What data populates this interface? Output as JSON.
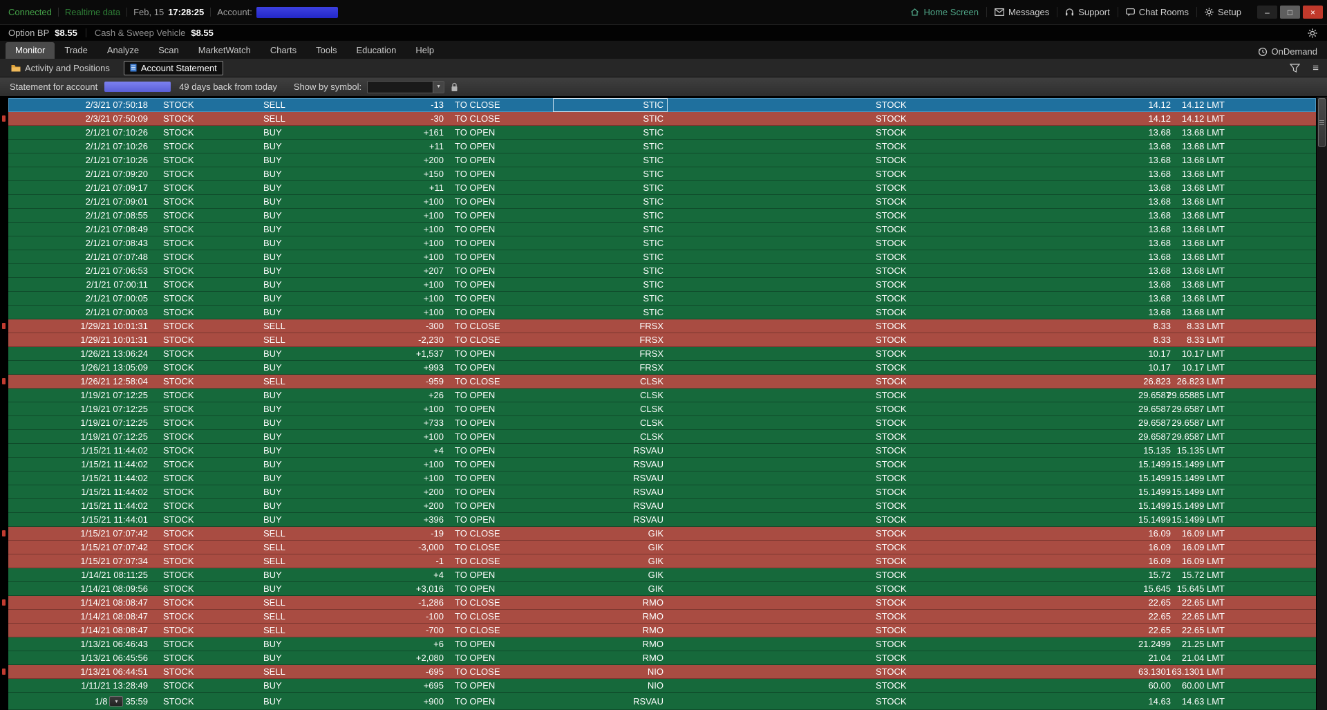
{
  "colors": {
    "buy_row": "#16693B",
    "sell_row": "#A94C42",
    "selected_row": "#1F709E",
    "account_redaction": "#3134D8",
    "statement_redaction": "#6B70E8",
    "connected_green": "#44A148",
    "close_button_red": "#C0392B",
    "folder_icon_orange": "#DFA238",
    "document_icon_blue": "#3B7BD0"
  },
  "top_bar": {
    "connection_status": "Connected",
    "data_status": "Realtime data",
    "date": "Feb, 15",
    "time": "17:28:25",
    "account_label": "Account:",
    "links": [
      {
        "label": "Home Screen",
        "icon": "home-icon"
      },
      {
        "label": "Messages",
        "icon": "envelope-icon"
      },
      {
        "label": "Support",
        "icon": "headset-icon"
      },
      {
        "label": "Chat Rooms",
        "icon": "chat-bubble-icon"
      },
      {
        "label": "Setup",
        "icon": "gear-icon"
      }
    ],
    "window_controls": {
      "minimize": "–",
      "maximize": "□",
      "close": "×"
    }
  },
  "bp_bar": {
    "option_bp_label": "Option BP",
    "option_bp_value": "$8.55",
    "sweep_label": "Cash & Sweep Vehicle",
    "sweep_value": "$8.55"
  },
  "menu": {
    "tabs": [
      "Monitor",
      "Trade",
      "Analyze",
      "Scan",
      "MarketWatch",
      "Charts",
      "Tools",
      "Education",
      "Help"
    ],
    "active": "Monitor",
    "ondemand_label": "OnDemand"
  },
  "subtabs": {
    "items": [
      {
        "label": "Activity and Positions",
        "icon": "folder-icon"
      },
      {
        "label": "Account Statement",
        "icon": "document-icon"
      }
    ],
    "active": "Account Statement"
  },
  "toolbar": {
    "statement_label": "Statement for account",
    "days_back_label": "49 days back from today",
    "show_by_label": "Show by symbol:",
    "symbol_dropdown_value": ""
  },
  "table": {
    "rows": [
      {
        "time": "2/3/21 07:50:18",
        "spread": "STOCK",
        "side": "SELL",
        "qty": "-13",
        "effect": "TO CLOSE",
        "symbol": "STIC",
        "type": "STOCK",
        "price": "14.12",
        "net": "14.12 LMT",
        "selected": true
      },
      {
        "time": "2/3/21 07:50:09",
        "spread": "STOCK",
        "side": "SELL",
        "qty": "-30",
        "effect": "TO CLOSE",
        "symbol": "STIC",
        "type": "STOCK",
        "price": "14.12",
        "net": "14.12 LMT"
      },
      {
        "time": "2/1/21 07:10:26",
        "spread": "STOCK",
        "side": "BUY",
        "qty": "+161",
        "effect": "TO OPEN",
        "symbol": "STIC",
        "type": "STOCK",
        "price": "13.68",
        "net": "13.68 LMT"
      },
      {
        "time": "2/1/21 07:10:26",
        "spread": "STOCK",
        "side": "BUY",
        "qty": "+11",
        "effect": "TO OPEN",
        "symbol": "STIC",
        "type": "STOCK",
        "price": "13.68",
        "net": "13.68 LMT"
      },
      {
        "time": "2/1/21 07:10:26",
        "spread": "STOCK",
        "side": "BUY",
        "qty": "+200",
        "effect": "TO OPEN",
        "symbol": "STIC",
        "type": "STOCK",
        "price": "13.68",
        "net": "13.68 LMT"
      },
      {
        "time": "2/1/21 07:09:20",
        "spread": "STOCK",
        "side": "BUY",
        "qty": "+150",
        "effect": "TO OPEN",
        "symbol": "STIC",
        "type": "STOCK",
        "price": "13.68",
        "net": "13.68 LMT"
      },
      {
        "time": "2/1/21 07:09:17",
        "spread": "STOCK",
        "side": "BUY",
        "qty": "+11",
        "effect": "TO OPEN",
        "symbol": "STIC",
        "type": "STOCK",
        "price": "13.68",
        "net": "13.68 LMT"
      },
      {
        "time": "2/1/21 07:09:01",
        "spread": "STOCK",
        "side": "BUY",
        "qty": "+100",
        "effect": "TO OPEN",
        "symbol": "STIC",
        "type": "STOCK",
        "price": "13.68",
        "net": "13.68 LMT"
      },
      {
        "time": "2/1/21 07:08:55",
        "spread": "STOCK",
        "side": "BUY",
        "qty": "+100",
        "effect": "TO OPEN",
        "symbol": "STIC",
        "type": "STOCK",
        "price": "13.68",
        "net": "13.68 LMT"
      },
      {
        "time": "2/1/21 07:08:49",
        "spread": "STOCK",
        "side": "BUY",
        "qty": "+100",
        "effect": "TO OPEN",
        "symbol": "STIC",
        "type": "STOCK",
        "price": "13.68",
        "net": "13.68 LMT"
      },
      {
        "time": "2/1/21 07:08:43",
        "spread": "STOCK",
        "side": "BUY",
        "qty": "+100",
        "effect": "TO OPEN",
        "symbol": "STIC",
        "type": "STOCK",
        "price": "13.68",
        "net": "13.68 LMT"
      },
      {
        "time": "2/1/21 07:07:48",
        "spread": "STOCK",
        "side": "BUY",
        "qty": "+100",
        "effect": "TO OPEN",
        "symbol": "STIC",
        "type": "STOCK",
        "price": "13.68",
        "net": "13.68 LMT"
      },
      {
        "time": "2/1/21 07:06:53",
        "spread": "STOCK",
        "side": "BUY",
        "qty": "+207",
        "effect": "TO OPEN",
        "symbol": "STIC",
        "type": "STOCK",
        "price": "13.68",
        "net": "13.68 LMT"
      },
      {
        "time": "2/1/21 07:00:11",
        "spread": "STOCK",
        "side": "BUY",
        "qty": "+100",
        "effect": "TO OPEN",
        "symbol": "STIC",
        "type": "STOCK",
        "price": "13.68",
        "net": "13.68 LMT"
      },
      {
        "time": "2/1/21 07:00:05",
        "spread": "STOCK",
        "side": "BUY",
        "qty": "+100",
        "effect": "TO OPEN",
        "symbol": "STIC",
        "type": "STOCK",
        "price": "13.68",
        "net": "13.68 LMT"
      },
      {
        "time": "2/1/21 07:00:03",
        "spread": "STOCK",
        "side": "BUY",
        "qty": "+100",
        "effect": "TO OPEN",
        "symbol": "STIC",
        "type": "STOCK",
        "price": "13.68",
        "net": "13.68 LMT"
      },
      {
        "time": "1/29/21 10:01:31",
        "spread": "STOCK",
        "side": "SELL",
        "qty": "-300",
        "effect": "TO CLOSE",
        "symbol": "FRSX",
        "type": "STOCK",
        "price": "8.33",
        "net": "8.33 LMT"
      },
      {
        "time": "1/29/21 10:01:31",
        "spread": "STOCK",
        "side": "SELL",
        "qty": "-2,230",
        "effect": "TO CLOSE",
        "symbol": "FRSX",
        "type": "STOCK",
        "price": "8.33",
        "net": "8.33 LMT"
      },
      {
        "time": "1/26/21 13:06:24",
        "spread": "STOCK",
        "side": "BUY",
        "qty": "+1,537",
        "effect": "TO OPEN",
        "symbol": "FRSX",
        "type": "STOCK",
        "price": "10.17",
        "net": "10.17 LMT"
      },
      {
        "time": "1/26/21 13:05:09",
        "spread": "STOCK",
        "side": "BUY",
        "qty": "+993",
        "effect": "TO OPEN",
        "symbol": "FRSX",
        "type": "STOCK",
        "price": "10.17",
        "net": "10.17 LMT"
      },
      {
        "time": "1/26/21 12:58:04",
        "spread": "STOCK",
        "side": "SELL",
        "qty": "-959",
        "effect": "TO CLOSE",
        "symbol": "CLSK",
        "type": "STOCK",
        "price": "26.823",
        "net": "26.823 LMT"
      },
      {
        "time": "1/19/21 07:12:25",
        "spread": "STOCK",
        "side": "BUY",
        "qty": "+26",
        "effect": "TO OPEN",
        "symbol": "CLSK",
        "type": "STOCK",
        "price": "29.6587",
        "net": "29.65885 LMT"
      },
      {
        "time": "1/19/21 07:12:25",
        "spread": "STOCK",
        "side": "BUY",
        "qty": "+100",
        "effect": "TO OPEN",
        "symbol": "CLSK",
        "type": "STOCK",
        "price": "29.6587",
        "net": "29.6587 LMT"
      },
      {
        "time": "1/19/21 07:12:25",
        "spread": "STOCK",
        "side": "BUY",
        "qty": "+733",
        "effect": "TO OPEN",
        "symbol": "CLSK",
        "type": "STOCK",
        "price": "29.6587",
        "net": "29.6587 LMT"
      },
      {
        "time": "1/19/21 07:12:25",
        "spread": "STOCK",
        "side": "BUY",
        "qty": "+100",
        "effect": "TO OPEN",
        "symbol": "CLSK",
        "type": "STOCK",
        "price": "29.6587",
        "net": "29.6587 LMT"
      },
      {
        "time": "1/15/21 11:44:02",
        "spread": "STOCK",
        "side": "BUY",
        "qty": "+4",
        "effect": "TO OPEN",
        "symbol": "RSVAU",
        "type": "STOCK",
        "price": "15.135",
        "net": "15.135 LMT"
      },
      {
        "time": "1/15/21 11:44:02",
        "spread": "STOCK",
        "side": "BUY",
        "qty": "+100",
        "effect": "TO OPEN",
        "symbol": "RSVAU",
        "type": "STOCK",
        "price": "15.1499",
        "net": "15.1499 LMT"
      },
      {
        "time": "1/15/21 11:44:02",
        "spread": "STOCK",
        "side": "BUY",
        "qty": "+100",
        "effect": "TO OPEN",
        "symbol": "RSVAU",
        "type": "STOCK",
        "price": "15.1499",
        "net": "15.1499 LMT"
      },
      {
        "time": "1/15/21 11:44:02",
        "spread": "STOCK",
        "side": "BUY",
        "qty": "+200",
        "effect": "TO OPEN",
        "symbol": "RSVAU",
        "type": "STOCK",
        "price": "15.1499",
        "net": "15.1499 LMT"
      },
      {
        "time": "1/15/21 11:44:02",
        "spread": "STOCK",
        "side": "BUY",
        "qty": "+200",
        "effect": "TO OPEN",
        "symbol": "RSVAU",
        "type": "STOCK",
        "price": "15.1499",
        "net": "15.1499 LMT"
      },
      {
        "time": "1/15/21 11:44:01",
        "spread": "STOCK",
        "side": "BUY",
        "qty": "+396",
        "effect": "TO OPEN",
        "symbol": "RSVAU",
        "type": "STOCK",
        "price": "15.1499",
        "net": "15.1499 LMT"
      },
      {
        "time": "1/15/21 07:07:42",
        "spread": "STOCK",
        "side": "SELL",
        "qty": "-19",
        "effect": "TO CLOSE",
        "symbol": "GIK",
        "type": "STOCK",
        "price": "16.09",
        "net": "16.09 LMT"
      },
      {
        "time": "1/15/21 07:07:42",
        "spread": "STOCK",
        "side": "SELL",
        "qty": "-3,000",
        "effect": "TO CLOSE",
        "symbol": "GIK",
        "type": "STOCK",
        "price": "16.09",
        "net": "16.09 LMT"
      },
      {
        "time": "1/15/21 07:07:34",
        "spread": "STOCK",
        "side": "SELL",
        "qty": "-1",
        "effect": "TO CLOSE",
        "symbol": "GIK",
        "type": "STOCK",
        "price": "16.09",
        "net": "16.09 LMT"
      },
      {
        "time": "1/14/21 08:11:25",
        "spread": "STOCK",
        "side": "BUY",
        "qty": "+4",
        "effect": "TO OPEN",
        "symbol": "GIK",
        "type": "STOCK",
        "price": "15.72",
        "net": "15.72 LMT"
      },
      {
        "time": "1/14/21 08:09:56",
        "spread": "STOCK",
        "side": "BUY",
        "qty": "+3,016",
        "effect": "TO OPEN",
        "symbol": "GIK",
        "type": "STOCK",
        "price": "15.645",
        "net": "15.645 LMT"
      },
      {
        "time": "1/14/21 08:08:47",
        "spread": "STOCK",
        "side": "SELL",
        "qty": "-1,286",
        "effect": "TO CLOSE",
        "symbol": "RMO",
        "type": "STOCK",
        "price": "22.65",
        "net": "22.65 LMT"
      },
      {
        "time": "1/14/21 08:08:47",
        "spread": "STOCK",
        "side": "SELL",
        "qty": "-100",
        "effect": "TO CLOSE",
        "symbol": "RMO",
        "type": "STOCK",
        "price": "22.65",
        "net": "22.65 LMT"
      },
      {
        "time": "1/14/21 08:08:47",
        "spread": "STOCK",
        "side": "SELL",
        "qty": "-700",
        "effect": "TO CLOSE",
        "symbol": "RMO",
        "type": "STOCK",
        "price": "22.65",
        "net": "22.65 LMT"
      },
      {
        "time": "1/13/21 06:46:43",
        "spread": "STOCK",
        "side": "BUY",
        "qty": "+6",
        "effect": "TO OPEN",
        "symbol": "RMO",
        "type": "STOCK",
        "price": "21.2499",
        "net": "21.25 LMT"
      },
      {
        "time": "1/13/21 06:45:56",
        "spread": "STOCK",
        "side": "BUY",
        "qty": "+2,080",
        "effect": "TO OPEN",
        "symbol": "RMO",
        "type": "STOCK",
        "price": "21.04",
        "net": "21.04 LMT"
      },
      {
        "time": "1/13/21 06:44:51",
        "spread": "STOCK",
        "side": "SELL",
        "qty": "-695",
        "effect": "TO CLOSE",
        "symbol": "NIO",
        "type": "STOCK",
        "price": "63.1301",
        "net": "63.1301 LMT"
      },
      {
        "time": "1/11/21 13:28:49",
        "spread": "STOCK",
        "side": "BUY",
        "qty": "+695",
        "effect": "TO OPEN",
        "symbol": "NIO",
        "type": "STOCK",
        "price": "60.00",
        "net": "60.00 LMT"
      },
      {
        "time_prefix": "1/8",
        "time_suffix": "35:59",
        "spread": "STOCK",
        "side": "BUY",
        "qty": "+900",
        "effect": "TO OPEN",
        "symbol": "RSVAU",
        "type": "STOCK",
        "price": "14.63",
        "net": "14.63 LMT",
        "partial": true
      }
    ]
  }
}
